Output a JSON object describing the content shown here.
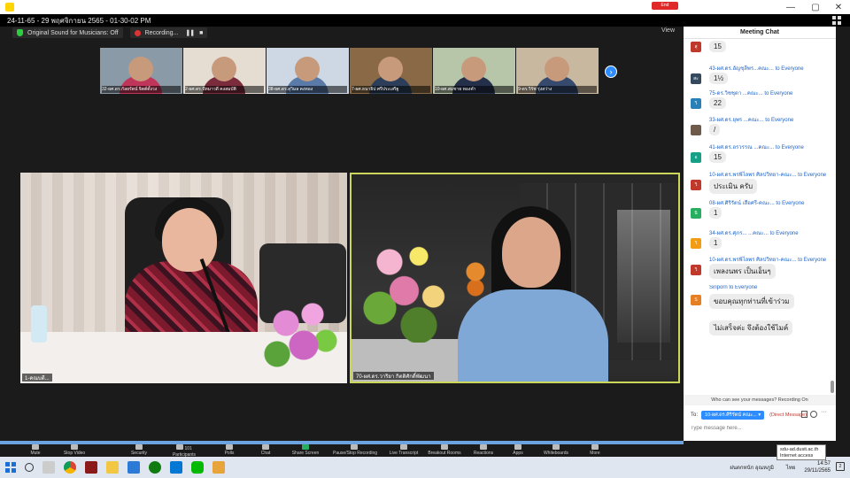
{
  "window": {
    "title": "24-11-65 - 29 พฤศจิกายน 2565 - 01-30-02 PM",
    "minimize": "—",
    "maximize": "▢",
    "close": "✕"
  },
  "meeting_bar": {
    "sound_label": "Original Sound for Musicians: Off",
    "recording_label": "Recording...",
    "pause_symbol": "❚❚",
    "stop_symbol": "■",
    "view_label": "View"
  },
  "thumbnails": [
    {
      "name": "32-ผศ.ดร.กัลยรัตน์ จิตต์ตั้งวง",
      "bg": "#8a9aa6",
      "body": "#c0365a"
    },
    {
      "name": "2-ผศ.ดร.ปัทมาวดี คงสมบัติ",
      "bg": "#e6ddd2",
      "body": "#7a2b3c"
    },
    {
      "name": "38-ผศ.ดร.สุวิมล คงทอง",
      "bg": "#cdd8e4",
      "body": "#5a7ba8"
    },
    {
      "name": "7-ผศ.ธนาธิป ศรีประเสริฐ",
      "bg": "#8a6a46",
      "body": "#2d3e5a"
    },
    {
      "name": "10-ผศ.สมชาย ทองคำ",
      "bg": "#b7c6a9",
      "body": "#24304a"
    },
    {
      "name": "9-ดร.วิรัช รุ่งสว่าง",
      "bg": "#c9b8a0",
      "body": "#364a6e"
    }
  ],
  "next_symbol": "›",
  "videos": {
    "left_label": "1-คณบดี...",
    "right_label": "70-ผศ.ดร.วาริยา กิตติศักดิ์พัฒนา"
  },
  "chat": {
    "header": "Meeting Chat",
    "messages": [
      {
        "initials": "สุ",
        "color": "#c0392b",
        "sender": "",
        "text": "15"
      },
      {
        "initials": "สะ",
        "color": "#34495e",
        "sender": "43-ผศ.ดร.อัญชุลีพร...คณะ... to Everyone",
        "text": "1½"
      },
      {
        "initials": "วิ",
        "color": "#2980b9",
        "sender": "75-ดร.วิชชุดา ...คณะ... to Everyone",
        "text": "22"
      },
      {
        "initials": "",
        "color": "#6d5a4a",
        "sender": "33-ผศ.ดร.ยุพร ...คณะ... to Everyone",
        "text": "/"
      },
      {
        "initials": "อ",
        "color": "#16a085",
        "sender": "41-ผศ.ดร.อรวรรณ ...คณะ... to Everyone",
        "text": "15"
      },
      {
        "initials": "วิ",
        "color": "#c0392b",
        "sender": "10-ผศ.ดร.พรพิไลพร ศิลปวิทยา-คณะ... to Everyone",
        "text": "ประเมิน ครับ"
      },
      {
        "initials": "นิ",
        "color": "#27ae60",
        "sender": "08-ผศ.ศิริรัตน์ เสือศรี-คณะ... to Everyone",
        "text": "1"
      },
      {
        "initials": "วิ",
        "color": "#f39c12",
        "sender": "34-ผศ.ดร.ศุภร... ...คณะ... to Everyone",
        "text": "1"
      },
      {
        "initials": "วิ",
        "color": "#c0392b",
        "sender": "10-ผศ.ดร.พรพิไลพร ศิลปวิทยา-คณะ... to Everyone",
        "text": "เพลงนพร เป็นเอ็นๆ"
      },
      {
        "initials": "S",
        "color": "#e67e22",
        "sender": "Siriporn to Everyone",
        "text": "ขอบคุณทุกท่านที่เข้าร่วม"
      },
      {
        "initials": "",
        "color": "#ffffff",
        "sender": "",
        "text": "ไม่เสร็จค่ะ จึงต้องใช้ไมค์"
      }
    ],
    "notice": "Who can see your messages? Recording On",
    "to_label": "To:",
    "to_value": "10-ผศ.ดร.ศิริรัตน์ คณะ...",
    "insert_label": "(Direct Message)",
    "more_symbol": "···",
    "input_placeholder": "Type message here..."
  },
  "toolbar": [
    {
      "key": "mute",
      "label": "Mute"
    },
    {
      "key": "video",
      "label": "Stop Video"
    },
    {
      "key": "security",
      "label": "Security"
    },
    {
      "key": "participants",
      "label": "Participants",
      "count": "101"
    },
    {
      "key": "polls",
      "label": "Polls"
    },
    {
      "key": "chat",
      "label": "Chat"
    },
    {
      "key": "share",
      "label": "Share Screen"
    },
    {
      "key": "recording",
      "label": "Pause/Stop Recording"
    },
    {
      "key": "transcript",
      "label": "Live Transcript"
    },
    {
      "key": "breakout",
      "label": "Breakout Rooms"
    },
    {
      "key": "reactions",
      "label": "Reactions"
    },
    {
      "key": "apps",
      "label": "Apps"
    },
    {
      "key": "whiteboards",
      "label": "Whiteboards"
    },
    {
      "key": "more",
      "label": "More"
    }
  ],
  "leave_label": "End",
  "tooltip": {
    "line1": "sdu-ad.dusit.ac.th",
    "line2": "Internet access"
  },
  "taskbar": {
    "weather": "ฝนตกหนัก อุณหภูมิ",
    "lang": "ไทย",
    "time": "14:57",
    "date": "29/11/2565",
    "notif_count": "2"
  }
}
